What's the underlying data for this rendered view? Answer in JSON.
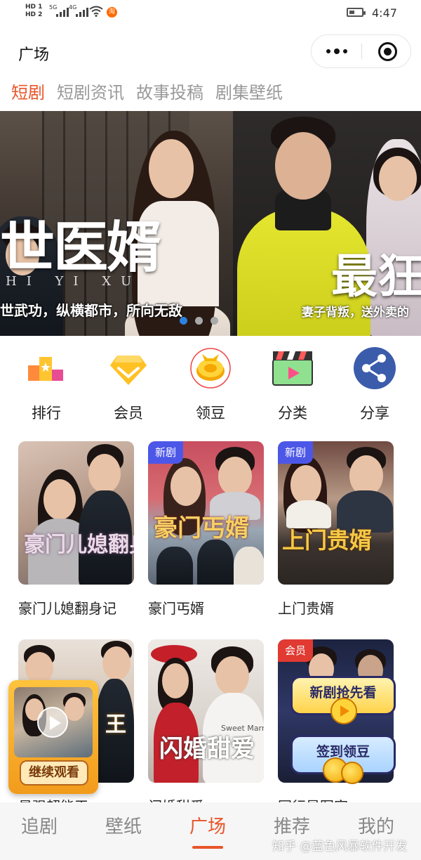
{
  "status_bar": {
    "sim1": "HD 1",
    "sim2": "HD 2",
    "net1": "5G",
    "net2": "4G",
    "taobao_badge": "淘",
    "time": "4:47"
  },
  "title_bar": {
    "title": "广场"
  },
  "top_tabs": [
    {
      "label": "短剧",
      "active": true
    },
    {
      "label": "短剧资讯",
      "active": false
    },
    {
      "label": "故事投稿",
      "active": false
    },
    {
      "label": "剧集壁纸",
      "active": false
    }
  ],
  "banner": {
    "slide1": {
      "title": "医婿",
      "title_prefix": "世",
      "pinyin": "HI YI XU",
      "subtitle": "世武功，纵横都市，所向无敌"
    },
    "slide2": {
      "title": "最狂",
      "subtitle": "妻子背叛，送外卖的"
    },
    "active_dot": 0,
    "dot_count": 3
  },
  "quick_menu": [
    {
      "label": "排行",
      "icon": "ranking-icon"
    },
    {
      "label": "会员",
      "icon": "vip-diamond-icon"
    },
    {
      "label": "领豆",
      "icon": "coin-bean-icon"
    },
    {
      "label": "分类",
      "icon": "category-clapper-icon"
    },
    {
      "label": "分享",
      "icon": "share-icon"
    }
  ],
  "cards": [
    {
      "title": "豪门儿媳翻身记",
      "poster_text": "豪门儿媳翻身记",
      "tag": ""
    },
    {
      "title": "豪门丐婿",
      "poster_text": "豪门丐婿",
      "tag": "新剧"
    },
    {
      "title": "上门贵婿",
      "poster_text": "上门贵婿",
      "tag": "新剧"
    },
    {
      "title": "最强超能王",
      "poster_text": "王",
      "tag": ""
    },
    {
      "title": "闪婚甜爱",
      "poster_text": "闪婚甜爱",
      "poster_sub": "Sweet Marriage",
      "tag": ""
    },
    {
      "title": "同行是冤家",
      "poster_text": "",
      "tag": "会员"
    }
  ],
  "floating": {
    "continue_label": "继续观看",
    "new_drama_label": "新剧抢先看",
    "checkin_label": "签到领豆"
  },
  "bottom_nav": [
    {
      "label": "追剧",
      "active": false
    },
    {
      "label": "壁纸",
      "active": false
    },
    {
      "label": "广场",
      "active": true
    },
    {
      "label": "推荐",
      "active": false
    },
    {
      "label": "我的",
      "active": false
    }
  ],
  "watermark": "知乎 @蓝色风暴软件开发",
  "colors": {
    "accent": "#e8552a",
    "tag_new": "#4c57e8",
    "tag_vip": "#e03a32",
    "dot_active": "#2c82e0"
  }
}
